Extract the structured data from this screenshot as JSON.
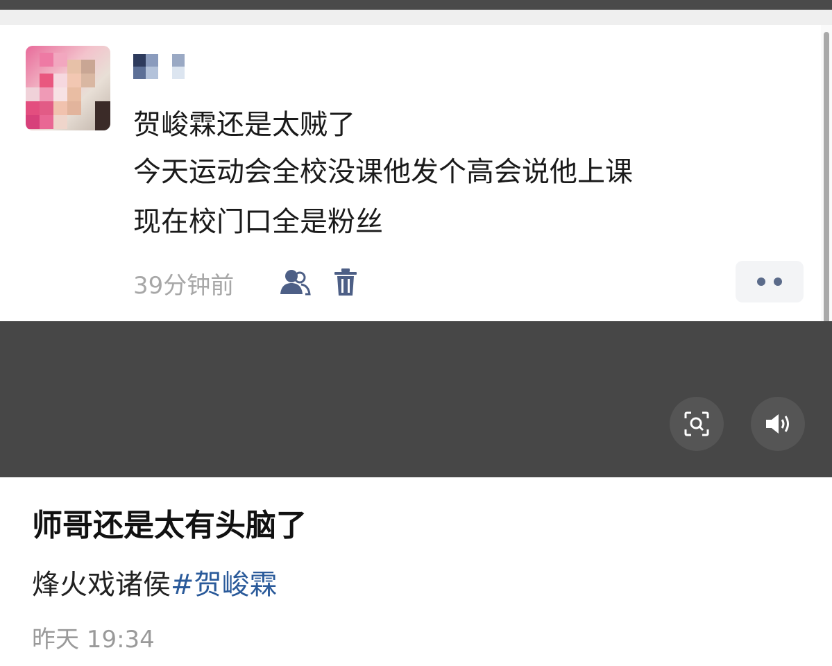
{
  "screenshot": {
    "username": "",
    "post_lines": [
      "贺峻霖还是太贼了",
      "今天运动会全校没课他发个高会说他上课",
      "现在校门口全是粉丝"
    ],
    "time": "39分钟前",
    "icons": {
      "friends": "friends-icon",
      "delete": "trash-icon",
      "more": "more-dots-icon"
    }
  },
  "media_controls": {
    "icons": [
      "image-search-icon",
      "speaker-icon"
    ]
  },
  "weibo": {
    "title": "师哥还是太有头脑了",
    "body_text": "烽火戏诸侯",
    "hashtag": "#贺峻霖",
    "time": "昨天 19:34"
  },
  "colors": {
    "hashtag": "#2a5a9a",
    "icon_blue": "#4d5f86",
    "dark_band": "#474747"
  }
}
